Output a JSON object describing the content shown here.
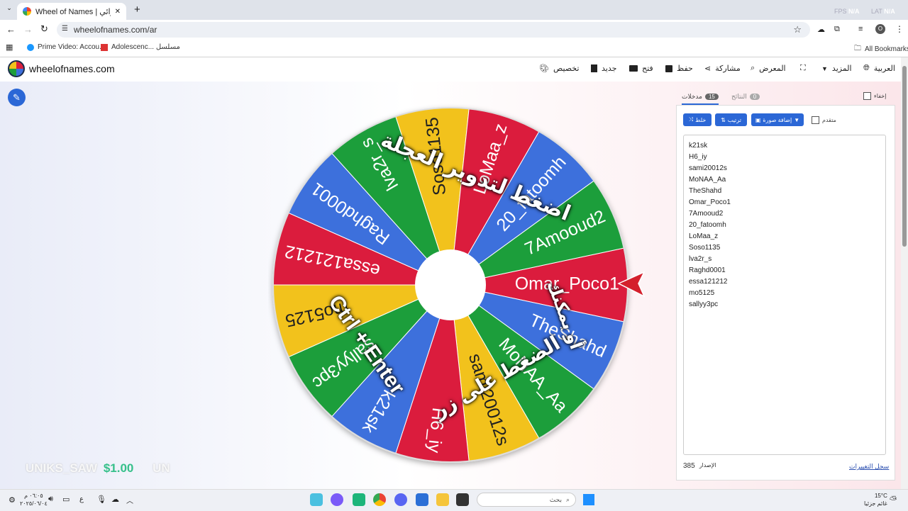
{
  "browser": {
    "tab_title": "Wheel of Names | أداة اختيار الاسم العشوائي",
    "new_tab": "+",
    "url": "wheelofnames.com/ar",
    "profile_initial": "O",
    "fps_label": "FPS",
    "fps_value": "N/A",
    "lat_label": "LAT",
    "lat_value": "N/A",
    "bookmarks": [
      "Prime Video: Accou...",
      "Adolescenc... مسلسل"
    ],
    "all_bookmarks": "All Bookmarks"
  },
  "app": {
    "logo_text": "wheelofnames.com",
    "nav": {
      "customize": "تخصيص",
      "new": "جديد",
      "open": "فتح",
      "save": "حفظ",
      "share": "مشاركة",
      "gallery": "المعرض",
      "more": "المزيد",
      "language": "العربية"
    }
  },
  "wheel": {
    "names": [
      "Omar_Poco1",
      "TheShahd",
      "MoNAA_Aa",
      "sami20012s",
      "H6_iy",
      "k21sk",
      "sallyy3pc",
      "mo5125",
      "essa121212",
      "Raghd0001",
      "lva2r_s",
      "Soso1135",
      "LoMaa_z",
      "20_fatoomh",
      "7Amooud2"
    ],
    "colors": [
      "#db1f3d",
      "#3e6fdc",
      "#1e9e3a",
      "#f2c21b"
    ],
    "instruction_top": "اضغط لتدوير العجلة",
    "instruction_or": "أو يمكنك",
    "instruction_bottom": "الضغط على زر",
    "shortcut": "Ctrl + Enter"
  },
  "ticker": {
    "left": "UNIKS_SAW",
    "amount": "$1.00",
    "right": "UN"
  },
  "panel": {
    "hide_label": "إخفاء",
    "results_tab": "النتائج",
    "results_count": "0",
    "entries_tab": "مدخلات",
    "entries_count": "15",
    "shuffle": "خلط",
    "sort": "ترتيب",
    "add_image": "إضافة صورة",
    "advanced": "متقدم",
    "entries": [
      "k21sk",
      "H6_iy",
      "sami20012s",
      "MoNAA_Aa",
      "TheShahd",
      "Omar_Poco1",
      "7Amooud2",
      "20_fatoomh",
      "LoMaa_z",
      "Soso1135",
      "lva2r_s",
      "Raghd0001",
      "essa121212",
      "mo5125",
      "sallyy3pc"
    ],
    "version_label": "الإصدار",
    "version": "385",
    "changelog": "سجل التغييرات"
  },
  "taskbar": {
    "search_placeholder": "بحث",
    "temperature": "15°C",
    "weather": "غائم جزئيا",
    "time": "٠٦:٠٥ م",
    "date": "٢٠٢٥/٠٦/٠٤",
    "lang": "ع"
  }
}
